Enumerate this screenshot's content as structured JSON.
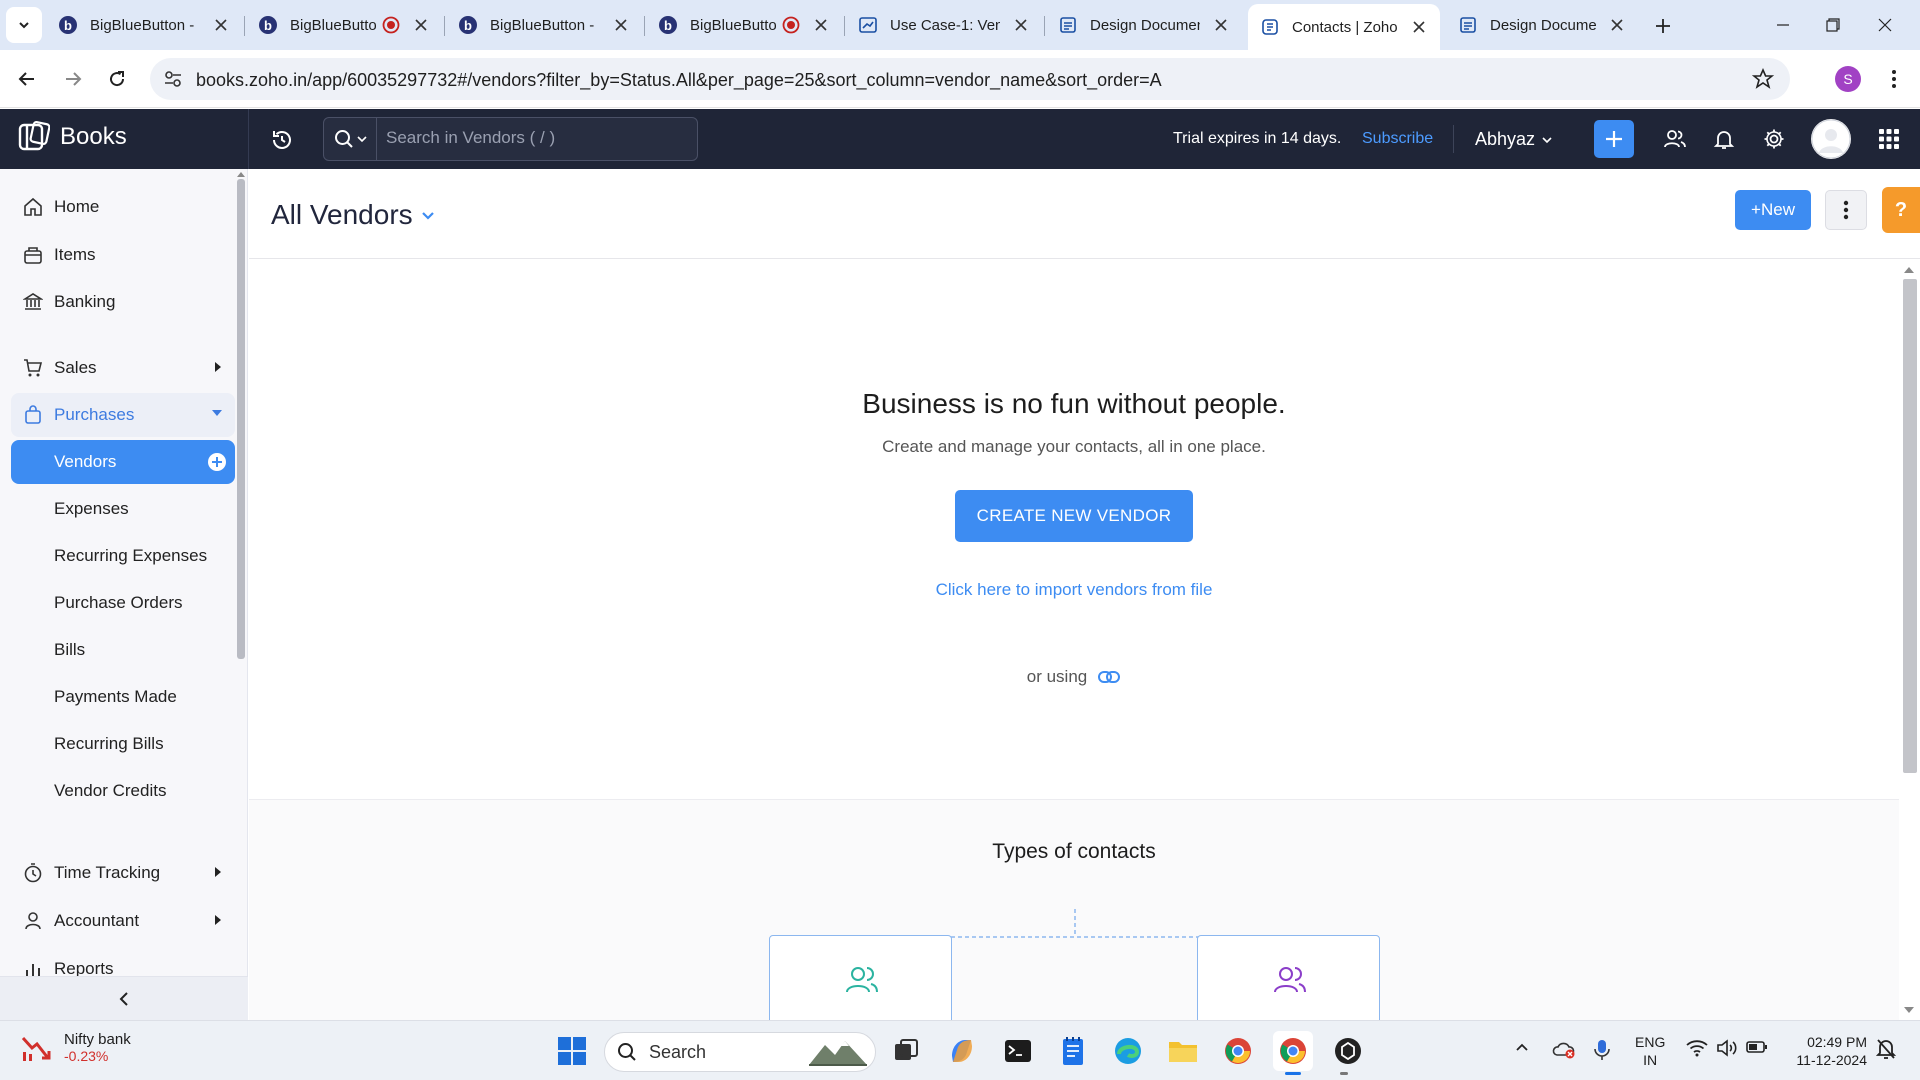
{
  "browser": {
    "tabs": [
      {
        "title": "BigBlueButton - ",
        "recording": false
      },
      {
        "title": "BigBlueButton",
        "recording": true
      },
      {
        "title": "BigBlueButton - ",
        "recording": false
      },
      {
        "title": "BigBlueButton",
        "recording": true
      },
      {
        "title": "Use Case-1: Vend",
        "recording": false
      },
      {
        "title": "Design Documen",
        "recording": false
      },
      {
        "title": "Contacts | Zoho",
        "recording": false,
        "active": true
      },
      {
        "title": "Design Documen",
        "recording": false
      }
    ],
    "url": "books.zoho.in/app/60035297732#/vendors?filter_by=Status.All&per_page=25&sort_column=vendor_name&sort_order=A",
    "profile_initial": "S"
  },
  "app": {
    "brand": "Books",
    "search_placeholder": "Search in Vendors ( / )",
    "trial_text": "Trial expires in 14 days.",
    "subscribe": "Subscribe",
    "org": "Abhyaz"
  },
  "sidebar": {
    "items": [
      {
        "label": "Home",
        "icon": "home-icon"
      },
      {
        "label": "Items",
        "icon": "items-icon"
      },
      {
        "label": "Banking",
        "icon": "bank-icon"
      },
      {
        "label": "Sales",
        "icon": "cart-icon"
      },
      {
        "label": "Purchases",
        "icon": "bag-icon"
      },
      {
        "label": "Time Tracking",
        "icon": "clock-icon"
      },
      {
        "label": "Accountant",
        "icon": "user-icon"
      },
      {
        "label": "Reports",
        "icon": "bar-chart-icon"
      }
    ],
    "purchases_sub": [
      "Vendors",
      "Expenses",
      "Recurring Expenses",
      "Purchase Orders",
      "Bills",
      "Payments Made",
      "Recurring Bills",
      "Vendor Credits"
    ]
  },
  "page": {
    "title": "All Vendors",
    "new_button": "+New",
    "help": "?",
    "empty_title": "Business is no fun without people.",
    "empty_subtitle": "Create and manage your contacts, all in one place.",
    "create_button": "CREATE NEW VENDOR",
    "import_link": "Click here to import vendors from file",
    "or_using": "or using",
    "types_title": "Types of contacts"
  },
  "taskbar": {
    "weather_name": "Nifty bank",
    "weather_value": "-0.23%",
    "search": "Search",
    "lang_top": "ENG",
    "lang_bottom": "IN",
    "time": "02:49 PM",
    "date": "11-12-2024"
  },
  "colors": {
    "accent": "#3d8cf2",
    "header_bg": "#1f2537",
    "help_orange": "#f59a2b"
  }
}
